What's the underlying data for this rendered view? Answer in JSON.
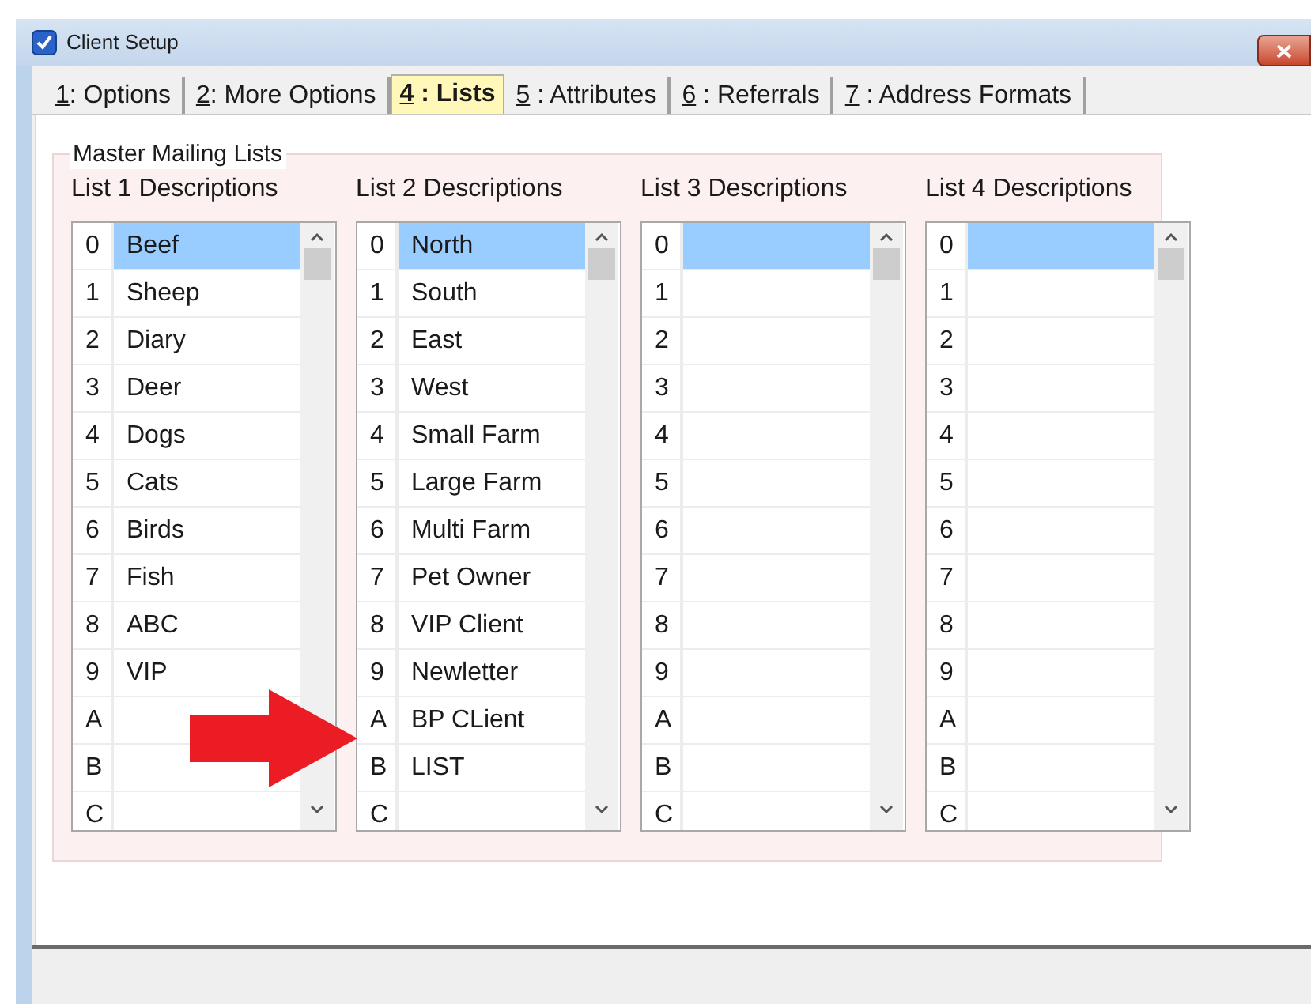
{
  "window": {
    "title": "Client Setup"
  },
  "tabs": [
    {
      "key": "1",
      "label": ": Options",
      "selected": false
    },
    {
      "key": "2",
      "label": ": More Options",
      "selected": false
    },
    {
      "key": "4",
      "label": " : Lists",
      "selected": true
    },
    {
      "key": "5",
      "label": " : Attributes",
      "selected": false
    },
    {
      "key": "6",
      "label": " : Referrals",
      "selected": false
    },
    {
      "key": "7",
      "label": " : Address Formats",
      "selected": false
    }
  ],
  "group": {
    "title": "Master Mailing Lists"
  },
  "lists": [
    {
      "title": "List 1 Descriptions",
      "rows": [
        {
          "index": "0",
          "text": "Beef",
          "selected": true
        },
        {
          "index": "1",
          "text": "Sheep",
          "selected": false
        },
        {
          "index": "2",
          "text": "Diary",
          "selected": false
        },
        {
          "index": "3",
          "text": "Deer",
          "selected": false
        },
        {
          "index": "4",
          "text": "Dogs",
          "selected": false
        },
        {
          "index": "5",
          "text": "Cats",
          "selected": false
        },
        {
          "index": "6",
          "text": "Birds",
          "selected": false
        },
        {
          "index": "7",
          "text": "Fish",
          "selected": false
        },
        {
          "index": "8",
          "text": "ABC",
          "selected": false
        },
        {
          "index": "9",
          "text": "VIP",
          "selected": false
        },
        {
          "index": "A",
          "selected": false
        },
        {
          "index": "B",
          "selected": false
        },
        {
          "index": "C",
          "selected": false
        }
      ]
    },
    {
      "title": "List 2 Descriptions",
      "rows": [
        {
          "index": "0",
          "text": "North",
          "selected": true
        },
        {
          "index": "1",
          "text": "South",
          "selected": false
        },
        {
          "index": "2",
          "text": "East",
          "selected": false
        },
        {
          "index": "3",
          "text": "West",
          "selected": false
        },
        {
          "index": "4",
          "text": "Small Farm",
          "selected": false
        },
        {
          "index": "5",
          "text": "Large Farm",
          "selected": false
        },
        {
          "index": "6",
          "text": "Multi Farm",
          "selected": false
        },
        {
          "index": "7",
          "text": "Pet Owner",
          "selected": false
        },
        {
          "index": "8",
          "text": "VIP Client",
          "selected": false
        },
        {
          "index": "9",
          "text": "Newletter",
          "selected": false
        },
        {
          "index": "A",
          "text": "BP CLient",
          "selected": false
        },
        {
          "index": "B",
          "text": "LIST",
          "selected": false
        },
        {
          "index": "C",
          "selected": false
        }
      ]
    },
    {
      "title": "List 3 Descriptions",
      "rows": [
        {
          "index": "0",
          "selected": true
        },
        {
          "index": "1",
          "selected": false
        },
        {
          "index": "2",
          "selected": false
        },
        {
          "index": "3",
          "selected": false
        },
        {
          "index": "4",
          "selected": false
        },
        {
          "index": "5",
          "selected": false
        },
        {
          "index": "6",
          "selected": false
        },
        {
          "index": "7",
          "selected": false
        },
        {
          "index": "8",
          "selected": false
        },
        {
          "index": "9",
          "selected": false
        },
        {
          "index": "A",
          "selected": false
        },
        {
          "index": "B",
          "selected": false
        },
        {
          "index": "C",
          "selected": false
        }
      ]
    },
    {
      "title": "List 4 Descriptions",
      "rows": [
        {
          "index": "0",
          "selected": true
        },
        {
          "index": "1",
          "selected": false
        },
        {
          "index": "2",
          "selected": false
        },
        {
          "index": "3",
          "selected": false
        },
        {
          "index": "4",
          "selected": false
        },
        {
          "index": "5",
          "selected": false
        },
        {
          "index": "6",
          "selected": false
        },
        {
          "index": "7",
          "selected": false
        },
        {
          "index": "8",
          "selected": false
        },
        {
          "index": "9",
          "selected": false
        },
        {
          "index": "A",
          "selected": false
        },
        {
          "index": "B",
          "selected": false
        },
        {
          "index": "C",
          "selected": false
        }
      ]
    }
  ]
}
